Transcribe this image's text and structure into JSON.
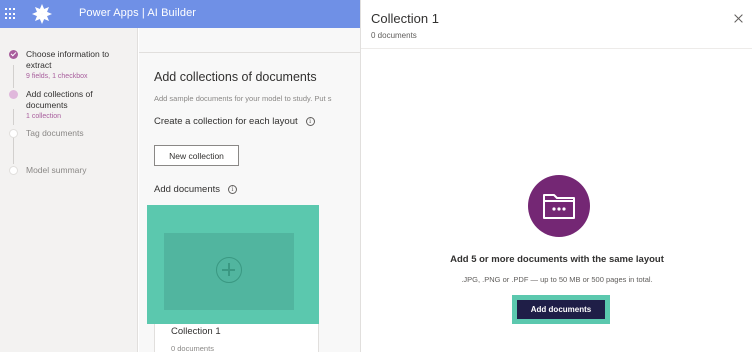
{
  "header": {
    "app_title": "Power Apps | AI Builder"
  },
  "sidebar": {
    "steps": [
      {
        "label": "Choose information to extract",
        "sub": "9 fields, 1 checkbox",
        "state": "done"
      },
      {
        "label": "Add collections of documents",
        "sub": "1 collection",
        "state": "current"
      },
      {
        "label": "Tag documents",
        "sub": "",
        "state": "todo"
      },
      {
        "label": "Model summary",
        "sub": "",
        "state": "todo"
      }
    ]
  },
  "main": {
    "title": "Add collections of documents",
    "description": "Add sample documents for your model to study. Put s",
    "create_heading": "Create a collection for each layout",
    "new_collection_label": "New collection",
    "add_documents_heading": "Add documents",
    "info_glyph": "i",
    "card": {
      "title": "Collection 1",
      "subtitle": "0 documents"
    }
  },
  "panel": {
    "title": "Collection 1",
    "subtitle": "0 documents",
    "close_label": "Close",
    "heading": "Add 5 or more documents with the same layout",
    "hint": ".JPG, .PNG or .PDF — up to 50 MB or 500 pages in total.",
    "add_button_label": "Add documents"
  },
  "colors": {
    "header_bg": "#6f90e6",
    "accent_purple": "#742774",
    "step_done": "#a85e9d",
    "highlight": "#5bc8ae",
    "primary_button": "#1f1e47"
  },
  "icons": [
    "waffle-icon",
    "power-apps-logo-icon",
    "checkmark-icon",
    "info-icon",
    "plus-circle-icon",
    "close-icon",
    "folder-icon"
  ]
}
